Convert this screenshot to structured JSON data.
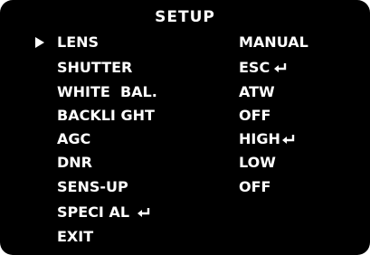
{
  "menu": {
    "title": "SETUP",
    "items": [
      {
        "label": "LENS",
        "value": "MANUAL",
        "selected": true
      },
      {
        "label": "SHUTTER",
        "value": "ESC",
        "value_icon": "enter-icon"
      },
      {
        "label": "WHITE  BAL.",
        "value": "ATW"
      },
      {
        "label": "BACKLI GHT",
        "value": "OFF"
      },
      {
        "label": "AGC",
        "value": "HIGH",
        "value_icon": "enter-icon"
      },
      {
        "label": "DNR",
        "value": "LOW"
      },
      {
        "label": "SENS-UP",
        "value": "OFF"
      },
      {
        "label": "SPECI AL",
        "value": "",
        "label_icon": "enter-icon"
      },
      {
        "label": "EXIT",
        "value": ""
      }
    ]
  },
  "colors": {
    "background": "#000000",
    "text": "#ffffff"
  },
  "icons": {
    "cursor": "right-triangle-cursor",
    "submenu": "enter-return-arrow"
  }
}
